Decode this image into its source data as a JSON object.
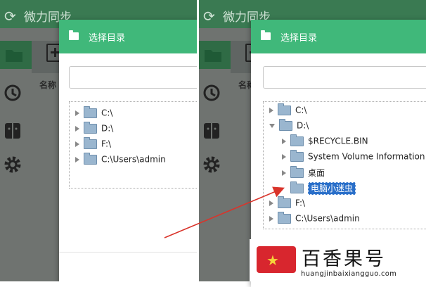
{
  "app": {
    "title": "微力同步",
    "column_header": "名称"
  },
  "dialog": {
    "title": "选择目录",
    "search_value": ""
  },
  "left_tree": [
    {
      "label": "C:\\",
      "expanded": false
    },
    {
      "label": "D:\\",
      "expanded": false
    },
    {
      "label": "F:\\",
      "expanded": false
    },
    {
      "label": "C:\\Users\\admin",
      "expanded": false
    }
  ],
  "right_tree": {
    "drive_c": "C:\\",
    "drive_d": "D:\\",
    "children_d": [
      "$RECYCLE.BIN",
      "System Volume Information",
      "桌面",
      "电脑小迷虫"
    ],
    "drive_f": "F:\\",
    "users": "C:\\Users\\admin",
    "selected": "电脑小迷虫"
  },
  "watermark": {
    "name": "百香果号",
    "url": "huangjinbaixiangguo.com"
  },
  "colors": {
    "dialog_header": "#40b87a",
    "app_header": "#3a7a52",
    "selection": "#2a6fc9",
    "arrow": "#d9342b"
  },
  "icons": [
    "refresh-icon",
    "folder-icon",
    "history-icon",
    "finder-icon",
    "gear-icon",
    "add-folder-icon",
    "tree-folder-icon"
  ]
}
